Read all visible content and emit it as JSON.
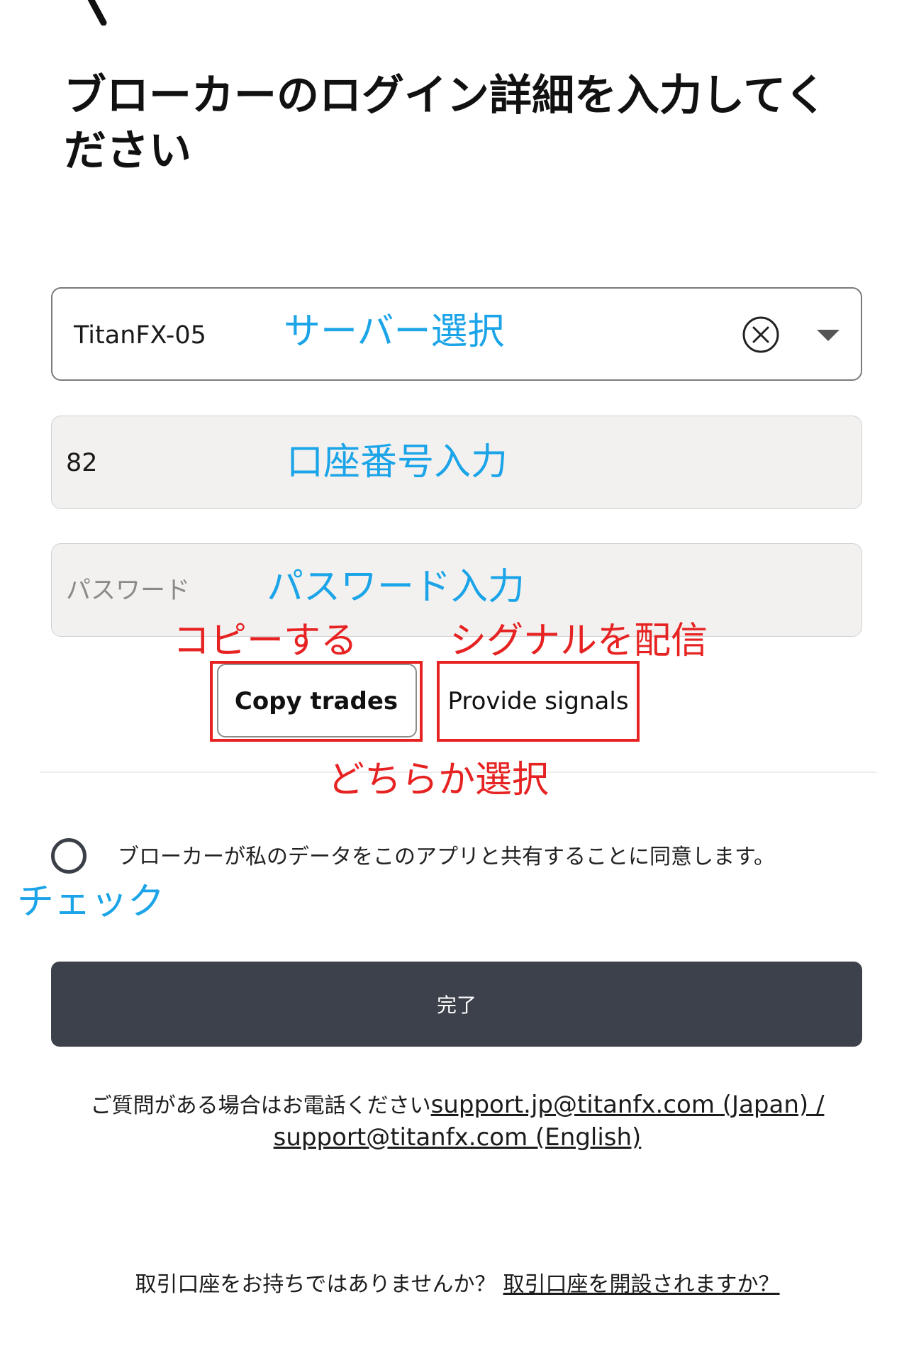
{
  "header": {
    "title": "ブローカーのログイン詳細を入力してください"
  },
  "server_field": {
    "value": "TitanFX-05",
    "clear_icon": "circle-x-icon",
    "dropdown_icon": "triangle-down-icon"
  },
  "account_field": {
    "value": "82"
  },
  "password_field": {
    "placeholder": "パスワード"
  },
  "mode_toggle": {
    "copy_label": "Copy trades",
    "provide_label": "Provide signals"
  },
  "consent": {
    "text": "ブローカーが私のデータをこのアプリと共有することに同意します。"
  },
  "submit": {
    "label": "完了"
  },
  "support": {
    "prefix": "ご質問がある場合はお電話ください",
    "link": "support.jp@titanfx.com (Japan) / support@titanfx.com (English)"
  },
  "footer": {
    "question": "取引口座をお持ちではありませんか？",
    "link": "取引口座を開設されますか？"
  },
  "annotations": {
    "server": "サーバー選択",
    "account": "口座番号入力",
    "password": "パスワード入力",
    "copy": "コピーする",
    "provide": "シグナルを配信",
    "choose": "どちらか選択",
    "check": "チェック"
  },
  "colors": {
    "annotation_blue": "#1ba4e8",
    "annotation_red": "#e62322",
    "button_dark": "#3d414b"
  }
}
